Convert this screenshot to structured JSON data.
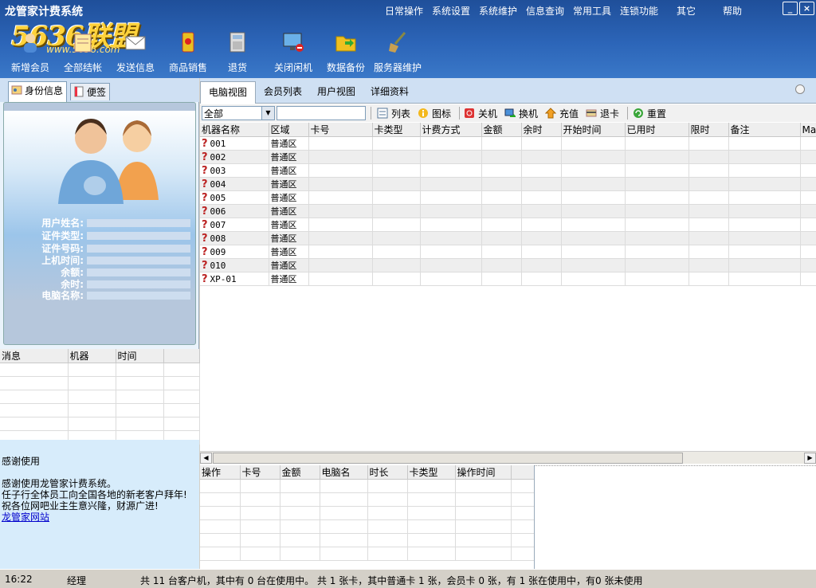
{
  "app": {
    "title": "龙管家计费系统",
    "logo": "5636联盟",
    "logo_url": "www.5636.com"
  },
  "menu": [
    "日常操作",
    "系统设置",
    "系统维护",
    "信息查询",
    "常用工具",
    "连锁功能",
    "其它",
    "帮助"
  ],
  "toolbar": [
    "新增会员",
    "全部结帐",
    "发送信息",
    "商品销售",
    "退货",
    "关闭闲机",
    "数据备份",
    "服务器维护"
  ],
  "left_tabs": [
    "身份信息",
    "便签"
  ],
  "identity_fields": [
    "用户姓名:",
    "证件类型:",
    "证件号码:",
    "上机时间:",
    "余额:",
    "余时:",
    "电脑名称:"
  ],
  "msg_columns": [
    "消息",
    "机器",
    "时间"
  ],
  "thanks": {
    "heading": "感谢使用",
    "lines": [
      "感谢使用龙管家计费系统。",
      "任子行全体员工向全国各地的新老客户拜年!",
      "祝各位网吧业主生意兴隆，财源广进!"
    ],
    "link": "龙管家网站"
  },
  "right_tabs": [
    "电脑视图",
    "会员列表",
    "用户视图",
    "详细资料"
  ],
  "filter": {
    "selected": "全部"
  },
  "filter_buttons": [
    "列表",
    "图标",
    "关机",
    "换机",
    "充值",
    "退卡",
    "重置"
  ],
  "pc_columns": [
    "机器名称",
    "区域",
    "卡号",
    "卡类型",
    "计费方式",
    "金额",
    "余时",
    "开始时间",
    "已用时",
    "限时",
    "备注",
    "Mac"
  ],
  "pc_rows": [
    {
      "name": "001",
      "zone": "普通区"
    },
    {
      "name": "002",
      "zone": "普通区"
    },
    {
      "name": "003",
      "zone": "普通区"
    },
    {
      "name": "004",
      "zone": "普通区"
    },
    {
      "name": "005",
      "zone": "普通区"
    },
    {
      "name": "006",
      "zone": "普通区"
    },
    {
      "name": "007",
      "zone": "普通区"
    },
    {
      "name": "008",
      "zone": "普通区"
    },
    {
      "name": "009",
      "zone": "普通区"
    },
    {
      "name": "010",
      "zone": "普通区"
    },
    {
      "name": "XP-01",
      "zone": "普通区"
    }
  ],
  "op_columns": [
    "操作",
    "卡号",
    "金额",
    "电脑名",
    "时长",
    "卡类型",
    "操作时间"
  ],
  "status": {
    "time": "16:22",
    "user": "经理",
    "summary": "共 11 台客户机，其中有 0 台在使用中。 共 1 张卡，其中普通卡 1 张，会员卡 0 张，有 1 张在使用中，有0 张未使用"
  },
  "colors": {
    "title_bg": "#2c65b8",
    "tab_bg": "#cfe0f3",
    "accent": "#b22222"
  }
}
